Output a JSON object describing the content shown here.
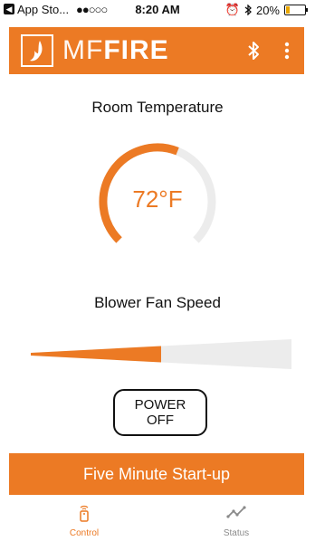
{
  "status_bar": {
    "back_app": "App Sto...",
    "signal": "●●○○○",
    "time": "8:20 AM",
    "battery": "20%"
  },
  "header": {
    "brand_light": "MF",
    "brand_bold": "FIRE"
  },
  "temperature": {
    "title": "Room Temperature",
    "value": "72°F",
    "gauge_level": 0.58
  },
  "fan": {
    "title": "Blower Fan Speed",
    "level": 0.5
  },
  "power_button": {
    "label": "POWER OFF"
  },
  "startup_button": {
    "label": "Five Minute Start-up"
  },
  "tabs": [
    {
      "label": "Control",
      "icon": "remote-icon",
      "active": true
    },
    {
      "label": "Status",
      "icon": "trend-icon",
      "active": false
    }
  ],
  "colors": {
    "accent": "#ec7a24",
    "track": "#ececec",
    "inactive": "#8a8a8a"
  }
}
